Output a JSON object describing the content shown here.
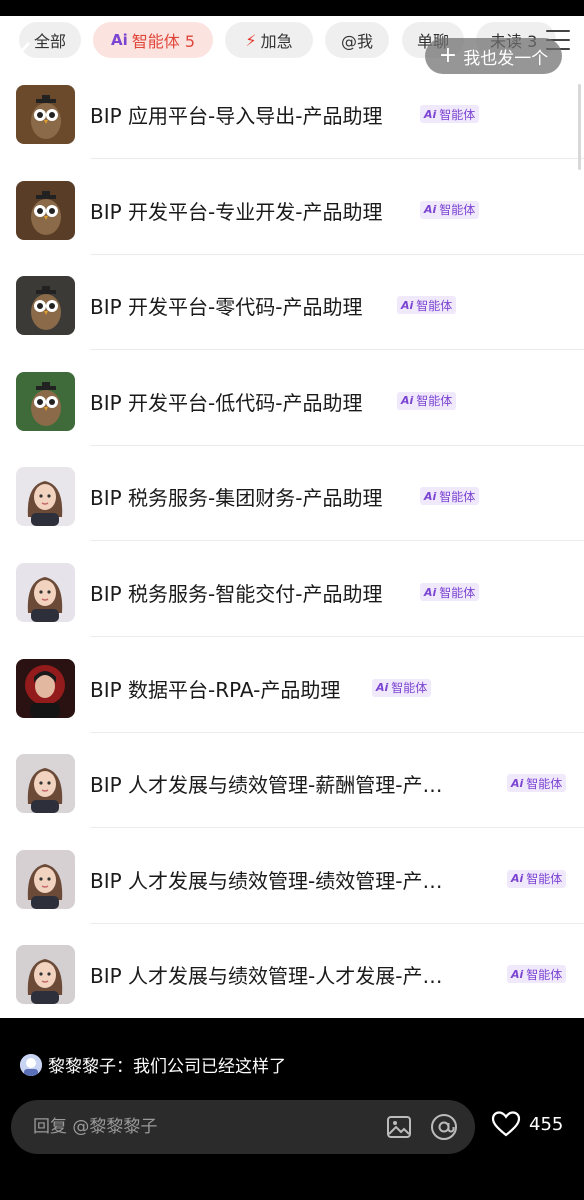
{
  "filters": {
    "all": "全部",
    "ai_label": "智能体 5",
    "ai_mark": "Ai",
    "urgent": "加急",
    "mentions": "@我",
    "single": "单聊",
    "unread": "未读 3"
  },
  "post_button": "我也发一个",
  "tag": {
    "mark": "Ai",
    "text": "智能体"
  },
  "agents": [
    {
      "name": "BIP 应用平台-导入导出-产品助理",
      "avatar": "owl-icon"
    },
    {
      "name": "BIP 开发平台-专业开发-产品助理",
      "avatar": "owl-icon"
    },
    {
      "name": "BIP 开发平台-零代码-产品助理",
      "avatar": "owl-icon"
    },
    {
      "name": "BIP 开发平台-低代码-产品助理",
      "avatar": "owl-icon"
    },
    {
      "name": "BIP 税务服务-集团财务-产品助理",
      "avatar": "woman-avatar-icon"
    },
    {
      "name": "BIP 税务服务-智能交付-产品助理",
      "avatar": "woman-avatar-icon"
    },
    {
      "name": "BIP 数据平台-RPA-产品助理",
      "avatar": "woman-avatar-icon"
    },
    {
      "name": "BIP 人才发展与绩效管理-薪酬管理-产…",
      "avatar": "woman-avatar-icon"
    },
    {
      "name": "BIP 人才发展与绩效管理-绩效管理-产…",
      "avatar": "woman-avatar-icon"
    },
    {
      "name": "BIP 人才发展与绩效管理-人才发展-产…",
      "avatar": "woman-avatar-icon"
    }
  ],
  "comment": {
    "author": "黎黎黎子",
    "text": "我们公司已经这样了"
  },
  "reply": {
    "placeholder": "回复 @黎黎黎子"
  },
  "likes": "455",
  "colors": {
    "accent": "#e0473b",
    "ai_purple": "#7b44d1",
    "tag_bg": "#f0e9fb"
  }
}
